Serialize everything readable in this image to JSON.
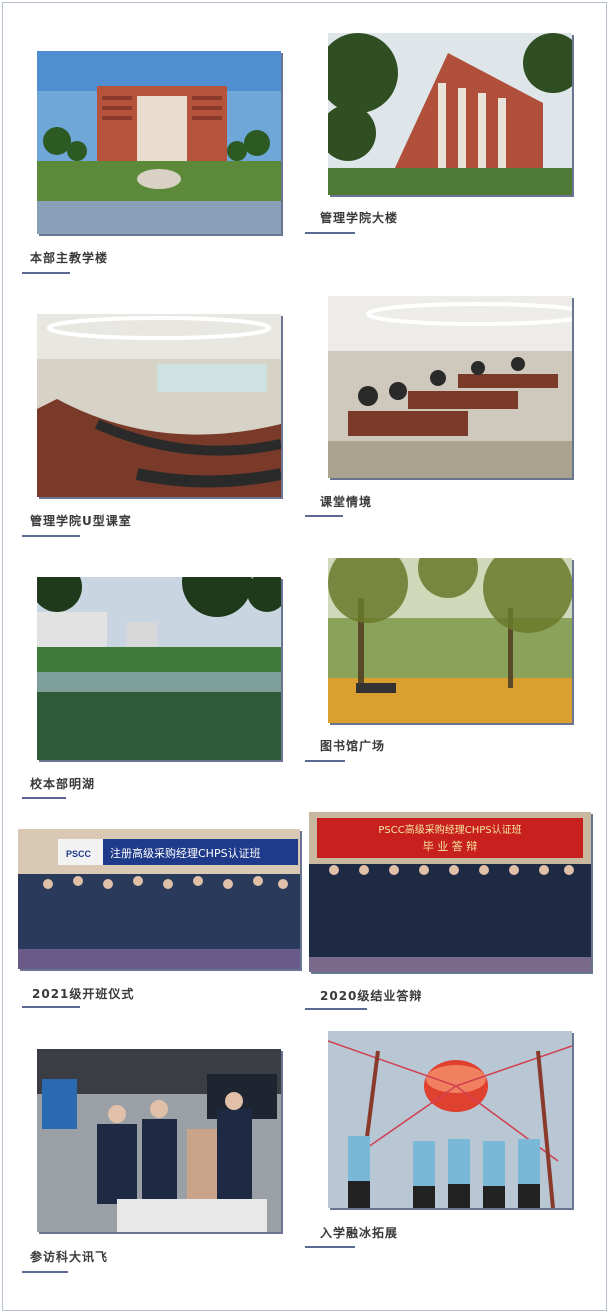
{
  "captions": {
    "c1": "本部主教学楼",
    "c2": "管理学院大楼",
    "c3": "管理学院U型课室",
    "c4": "课堂情境",
    "c5": "校本部明湖",
    "c6": "图书馆广场",
    "c7": "2021级开班仪式",
    "c8": "2020级结业答辩",
    "c9": "参访科大讯飞",
    "c10": "入学融冰拓展"
  },
  "banners": {
    "b7_logo": "PSCC",
    "b7_text": "注册高级采购经理CHPS认证班",
    "b8_line1": "PSCC高级采购经理CHPS认证班",
    "b8_line2": "毕 业 答 辩"
  }
}
